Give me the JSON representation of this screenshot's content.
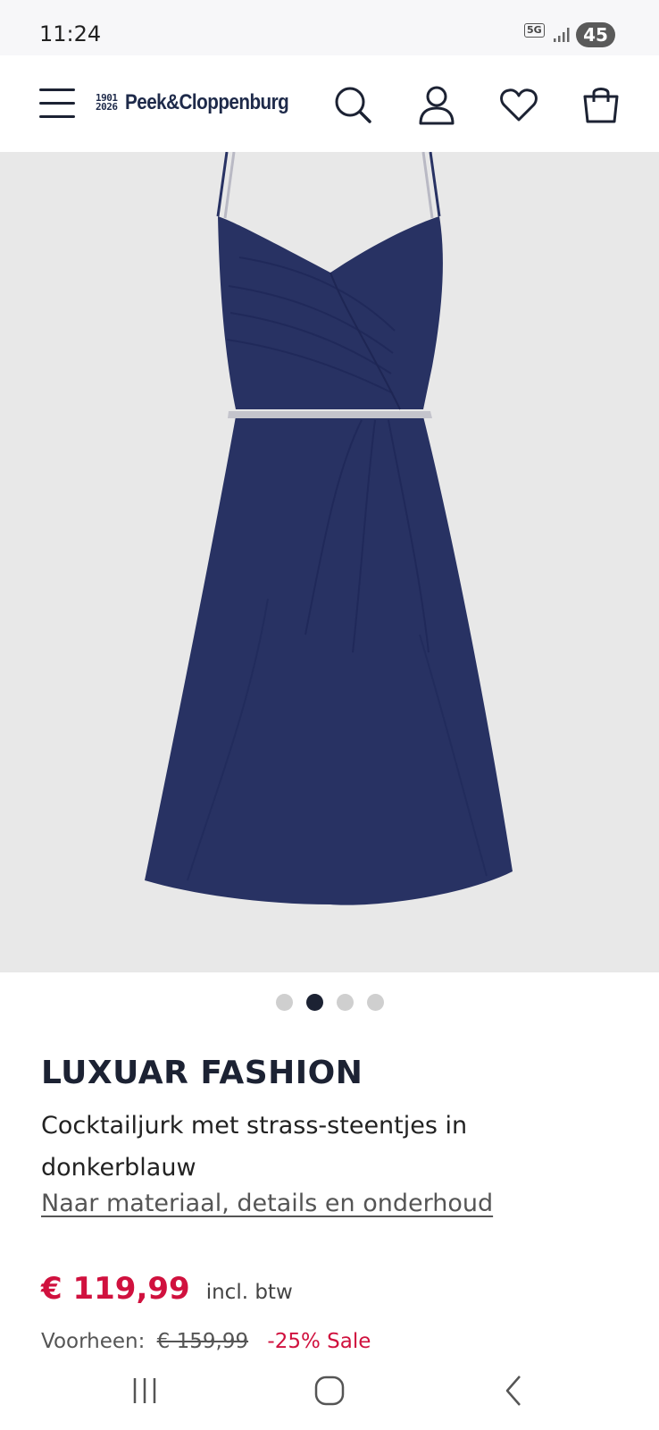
{
  "status_bar": {
    "time": "11:24",
    "network": "5G",
    "battery": "45"
  },
  "header": {
    "logo_years": [
      "1901",
      "2026"
    ],
    "logo_name": "Peek&Cloppenburg",
    "icons": [
      "menu-icon",
      "search-icon",
      "account-icon",
      "heart-icon",
      "shopping-bag-icon"
    ]
  },
  "gallery": {
    "image_alt": "navy-dress-photo",
    "dot_count": 4,
    "active_index": 1
  },
  "product": {
    "brand": "LUXUAR FASHION",
    "name": "Cocktailjurk met strass-steentjes in donkerblauw",
    "details_link": "Naar materiaal, details en onderhoud",
    "price": "€ 119,99",
    "vat_label": "incl. btw",
    "previous_label": "Voorheen:",
    "previous_price": "€ 159,99",
    "discount_label": "-25% Sale"
  },
  "colors": {
    "accent": "#d0113e",
    "navy": "#1c2233",
    "dress": "#283263",
    "hero_bg": "#e8e8e8"
  },
  "system_nav": [
    "recent-apps-icon",
    "home-icon",
    "back-icon"
  ]
}
